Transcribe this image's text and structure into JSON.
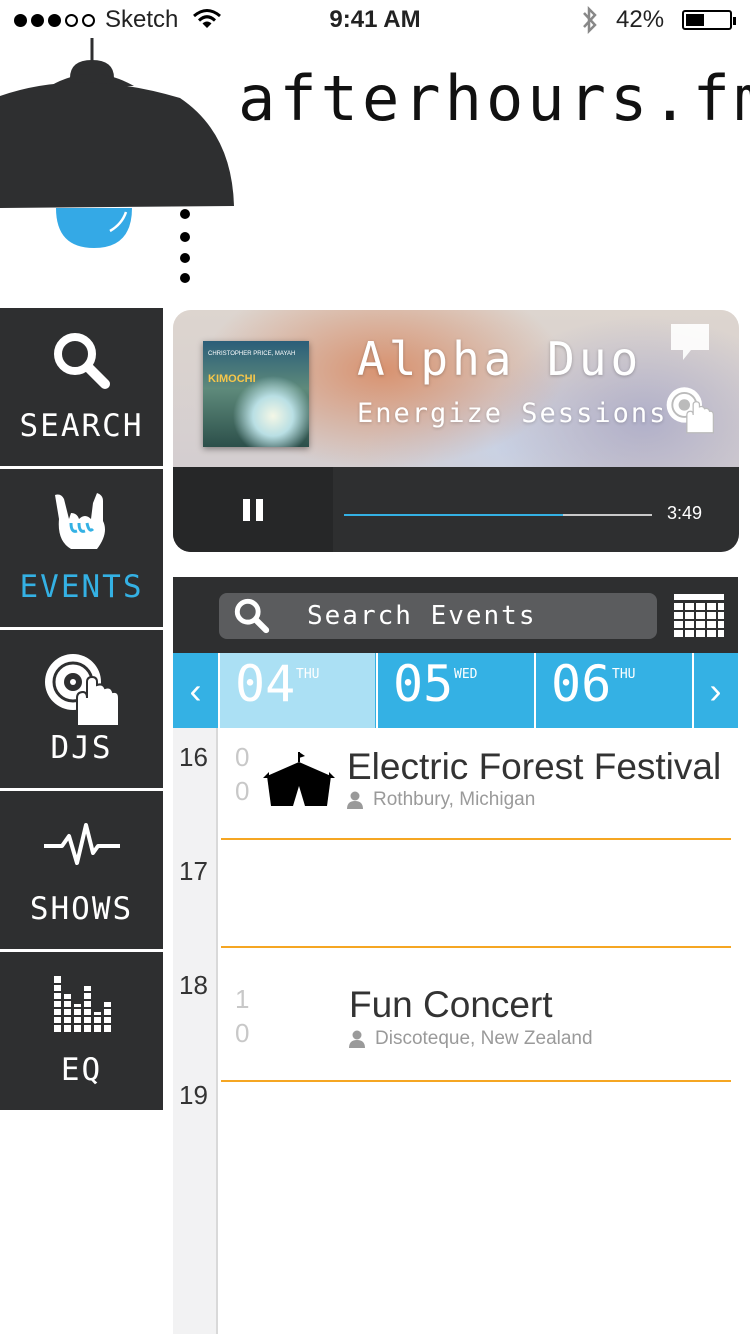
{
  "status_bar": {
    "carrier": "Sketch",
    "time": "9:41 AM",
    "battery": "42%",
    "battery_level": 0.42
  },
  "header": {
    "brand": "afterhours.fm"
  },
  "sidebar": {
    "items": [
      {
        "label": "SEARCH",
        "icon": "search-icon",
        "active": false
      },
      {
        "label": "EVENTS",
        "icon": "rock-hand-icon",
        "active": true
      },
      {
        "label": "DJS",
        "icon": "dj-turntable-icon",
        "active": false
      },
      {
        "label": "SHOWS",
        "icon": "pulse-icon",
        "active": false
      },
      {
        "label": "EQ",
        "icon": "equalizer-icon",
        "active": false
      }
    ]
  },
  "player": {
    "artist": "Alpha Duo",
    "show": "Energize Sessions",
    "album_title": "KIMOCHI",
    "album_subtitle": "CHRISTOPHER PRICE, MAYAH",
    "time": "3:49",
    "progress": 0.71
  },
  "events": {
    "search_placeholder": "Search Events",
    "dates": [
      {
        "num": "04",
        "dow": "THU",
        "selected": true
      },
      {
        "num": "05",
        "dow": "WED",
        "selected": false
      },
      {
        "num": "06",
        "dow": "THU",
        "selected": false
      }
    ],
    "hours": [
      "16",
      "17",
      "18",
      "19"
    ],
    "items": [
      {
        "minute_tens": "0",
        "minute_ones": "0",
        "title": "Electric Forest Festival",
        "location": "Rothbury, Michigan"
      },
      {
        "minute_tens": "1",
        "minute_ones": "0",
        "title": "Fun Concert",
        "location": "Discoteque, New Zealand"
      }
    ]
  },
  "colors": {
    "accent": "#34b1e4",
    "panel": "#2e2f30",
    "separator": "#f5a623"
  }
}
